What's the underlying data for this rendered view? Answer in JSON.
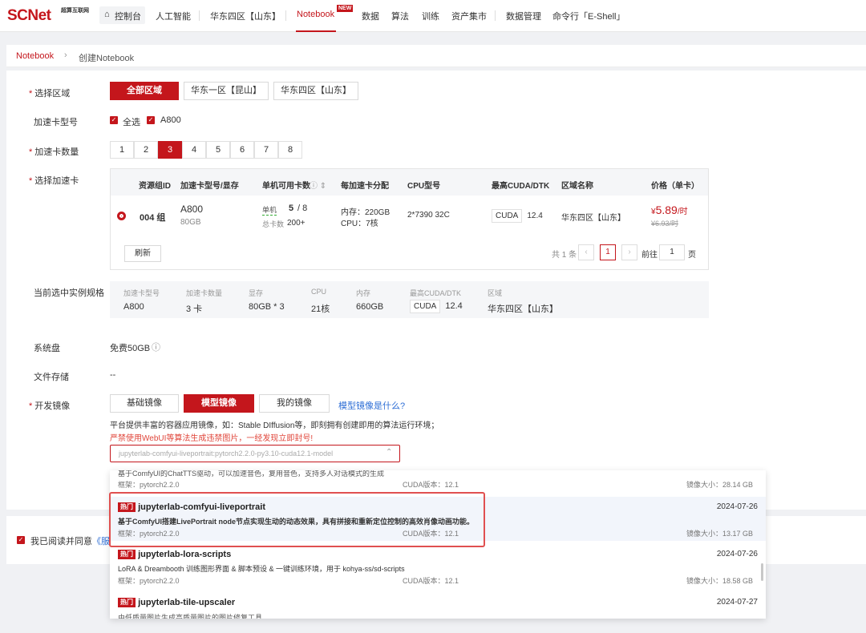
{
  "nav": {
    "logo": "SCNet",
    "logo_sub": "超算互联网",
    "home": "控制台",
    "items": [
      "人工智能",
      "华东四区【山东】",
      "Notebook",
      "数据",
      "算法",
      "训练",
      "资产集市",
      "数据管理",
      "命令行「E-Shell」"
    ],
    "new_badge": "NEW"
  },
  "breadcrumb": {
    "root": "Notebook",
    "sep": "›",
    "current": "创建Notebook"
  },
  "form": {
    "region_label": "选择区域",
    "regions": [
      "全部区域",
      "华东一区【昆山】",
      "华东四区【山东】"
    ],
    "card_type_label": "加速卡型号",
    "select_all": "全选",
    "card_type": "A800",
    "card_count_label": "加速卡数量",
    "counts": [
      "1",
      "2",
      "3",
      "4",
      "5",
      "6",
      "7",
      "8"
    ],
    "select_card_label": "选择加速卡",
    "table_headers": [
      "资源组ID",
      "加速卡型号/显存",
      "单机可用卡数",
      "每加速卡分配",
      "CPU型号",
      "最高CUDA/DTK",
      "区域名称",
      "价格（单卡）"
    ],
    "row": {
      "group": "004 组",
      "card": "A800",
      "mem": "80GB",
      "single_label": "单机",
      "single_val": "5",
      "single_total": "/ 8",
      "total_label": "总卡数",
      "total_val": "200+",
      "mem_alloc": "内存：220GB",
      "cpu_alloc": "CPU：7核",
      "cpu_model": "2*7390 32C",
      "cuda_tag": "CUDA",
      "cuda_ver": "12.4",
      "region": "华东四区【山东】",
      "price_symbol": "¥",
      "price": "5.89",
      "price_unit": "/时",
      "orig_price": "¥6.93/时"
    },
    "refresh": "刷新",
    "pager": {
      "total": "共 1 条",
      "prev": "‹",
      "page": "1",
      "next": "›",
      "goto": "前往",
      "goto_val": "1",
      "page_unit": "页"
    },
    "spec_label": "当前选中实例规格",
    "spec": {
      "h": [
        "加速卡型号",
        "加速卡数量",
        "显存",
        "CPU",
        "内存",
        "最高CUDA/DTK",
        "区域"
      ],
      "v": [
        "A800",
        "3 卡",
        "80GB * 3",
        "21核",
        "660GB",
        "12.4",
        "华东四区【山东】"
      ],
      "cuda_tag": "CUDA"
    },
    "disk_label": "系统盘",
    "disk_value": "免费50GB",
    "storage_label": "文件存储",
    "storage_value": "--",
    "image_label": "开发镜像",
    "image_tabs": [
      "基础镜像",
      "模型镜像",
      "我的镜像"
    ],
    "image_help": "模型镜像是什么?",
    "image_desc": "平台提供丰富的容器应用镜像，如：Stable DIffusion等，即刻拥有创建即用的算法运行环境；",
    "image_warn": "严禁使用WebUI等算法生成违禁图片，一经发现立即封号!",
    "image_selected": "jupyterlab-comfyui-liveportrait:pytorch2.2.0-py3.10-cuda12.1-model"
  },
  "dropdown": {
    "partial": {
      "desc": "基于ComfyUI的ChatTTS驱动，可以加速音色，复用音色，支持多人对话模式的生成",
      "frame": "框架：pytorch2.2.0",
      "cuda": "CUDA版本：12.1",
      "size": "镜像大小：28.14 GB"
    },
    "items": [
      {
        "hot": "热门",
        "title": "jupyterlab-comfyui-liveportrait",
        "date": "2024-07-26",
        "desc": "基于ComfyUI搭建LivePortrait node节点实现生动的动态效果，具有拼接和重新定位控制的高效肖像动画功能。",
        "frame": "框架：pytorch2.2.0",
        "cuda": "CUDA版本：12.1",
        "size": "镜像大小：13.17 GB"
      },
      {
        "hot": "热门",
        "title": "jupyterlab-lora-scripts",
        "date": "2024-07-26",
        "desc": "LoRA & Dreambooth 训练图形界面 & 脚本预设 & 一键训练环境，用于 kohya-ss/sd-scripts",
        "frame": "框架：pytorch2.2.0",
        "cuda": "CUDA版本：12.1",
        "size": "镜像大小：18.58 GB"
      },
      {
        "hot": "热门",
        "title": "jupyterlab-tile-upscaler",
        "date": "2024-07-27",
        "desc": "由低质量图片生成高质量图片的图片修复工具"
      }
    ]
  },
  "agree": {
    "text": "我已阅读并同意",
    "link": "《服务"
  }
}
